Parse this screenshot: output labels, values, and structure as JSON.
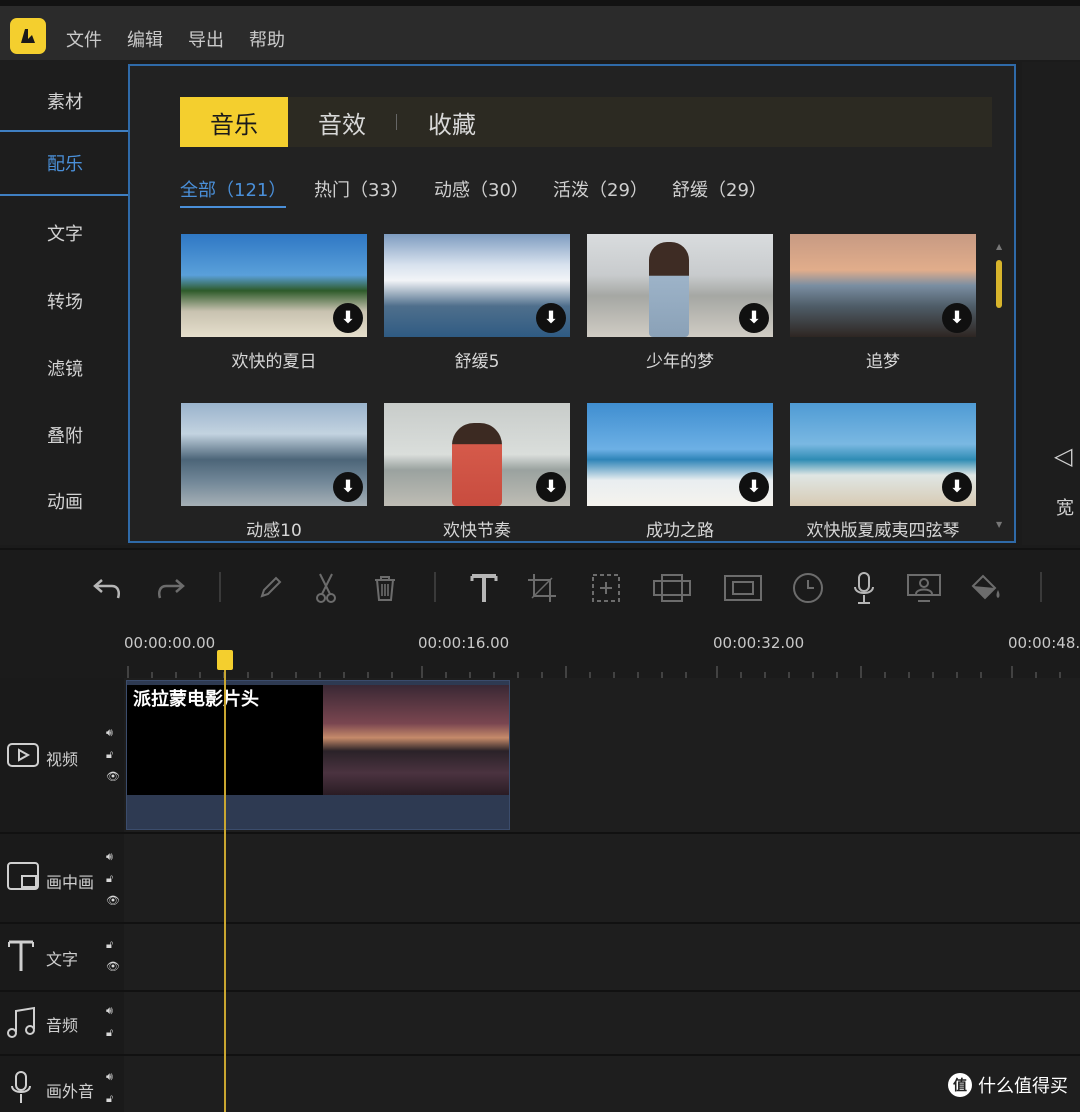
{
  "app": {
    "logo": "logo-icon"
  },
  "menu": [
    "文件",
    "编辑",
    "导出",
    "帮助"
  ],
  "sidebar": [
    "素材",
    "配乐",
    "文字",
    "转场",
    "滤镜",
    "叠附",
    "动画"
  ],
  "tabs": [
    "音乐",
    "音效",
    "收藏"
  ],
  "filters": [
    "全部（121）",
    "热门（33）",
    "动感（30）",
    "活泼（29）",
    "舒缓（29）"
  ],
  "music_cards": [
    {
      "label": "欢快的夏日",
      "scene": "tropical beach"
    },
    {
      "label": "舒缓5",
      "scene": "snowy mountains"
    },
    {
      "label": "少年的梦",
      "scene": "girl on beach"
    },
    {
      "label": "追梦",
      "scene": "sunset shore"
    },
    {
      "label": "动感10",
      "scene": "mountain range"
    },
    {
      "label": "欢快节奏",
      "scene": "girl in red"
    },
    {
      "label": "成功之路",
      "scene": "white sand coast"
    },
    {
      "label": "欢快版夏威夷四弦琴",
      "scene": "beach people"
    }
  ],
  "right_panel": {
    "partial_label": "宽"
  },
  "timeline": {
    "times": [
      "00:00:00.00",
      "00:00:16.00",
      "00:00:32.00",
      "00:00:48."
    ],
    "clip_title": "派拉蒙电影片头"
  },
  "tracks": [
    "视频",
    "画中画",
    "文字",
    "音频",
    "画外音"
  ],
  "watermark": "什么值得买",
  "colors": {
    "accent": "#f4cf2e",
    "active_blue": "#4a8fd8",
    "panel_border": "#2f6aa8"
  }
}
